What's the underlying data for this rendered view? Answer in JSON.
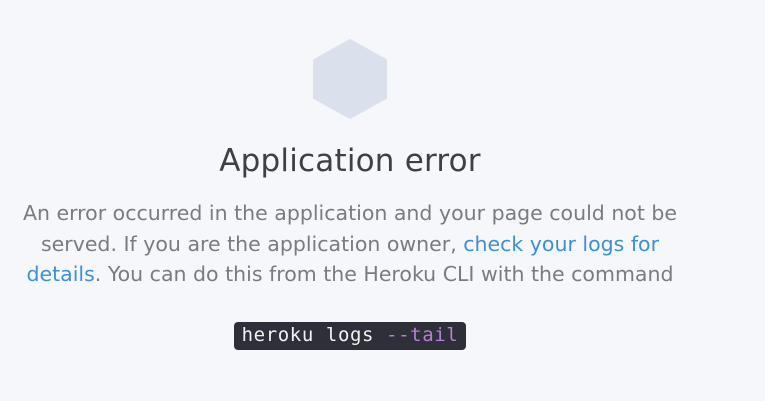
{
  "logo": {
    "icon": "hexagon-icon",
    "color": "#dbe1ec"
  },
  "title": "Application error",
  "message": {
    "part1": "An error occurred in the application and your page could not be served. If you are the application owner, ",
    "link": "check your logs for details",
    "part2": ". You can do this from the Heroku CLI with the command"
  },
  "command": {
    "base": "heroku logs ",
    "flag": "--tail"
  },
  "colors": {
    "background": "#f6f7fb",
    "link": "#3d8fd9",
    "command_bg": "#2e2f38",
    "command_flag": "#b77fd1"
  }
}
